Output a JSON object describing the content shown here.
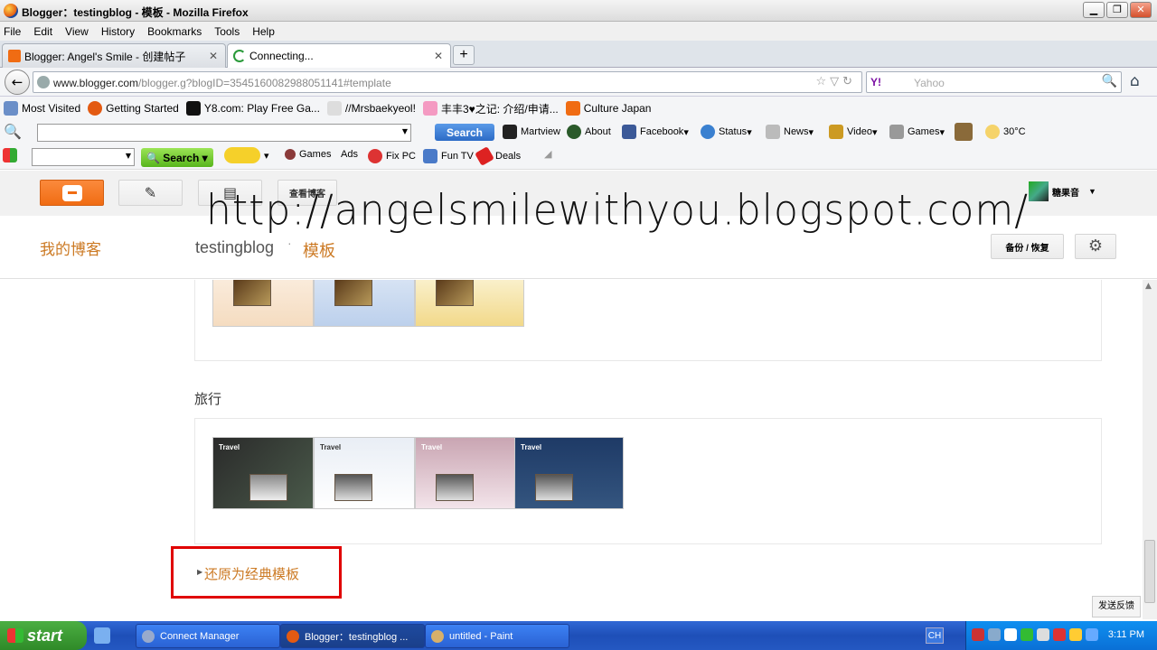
{
  "window": {
    "title": "Blogger：testingblog - 模板 - Mozilla Firefox"
  },
  "menu": [
    "File",
    "Edit",
    "View",
    "History",
    "Bookmarks",
    "Tools",
    "Help"
  ],
  "tabs": [
    {
      "label": "Blogger: Angel's Smile - 创建帖子",
      "active": false
    },
    {
      "label": "Connecting...",
      "active": true
    }
  ],
  "nav": {
    "url_host": "www.blogger.com",
    "url_path": "/blogger.g?blogID=3545160082988051141#template",
    "search_engine": "Y!",
    "search_placeholder": "Yahoo"
  },
  "bookmarks": [
    "Most Visited",
    "Getting Started",
    "Y8.com: Play Free Ga...",
    "//Mrsbaekyeol!",
    "丰丰3♥之记: 介绍/申请...",
    "Culture Japan"
  ],
  "toolbar1": {
    "search_button": "Search",
    "items": [
      "Martview",
      "About",
      "Facebook",
      "Status",
      "News",
      "Video",
      "Games",
      "30°C"
    ]
  },
  "toolbar2": {
    "search_button": "Search",
    "items": [
      "Games",
      "Ads",
      "Fix PC",
      "Fun TV",
      "Deals"
    ]
  },
  "blogger": {
    "view_blog_label": "查看博客",
    "username": "糖果音",
    "my_blogs": "我的博客",
    "blog_name": "testingblog",
    "separator": "·",
    "section": "模板",
    "backup_label": "备份 / 恢复",
    "watermark": "http://angelsmilewithyou.blogspot.com/"
  },
  "content": {
    "category_travel": "旅行",
    "travel_thumb_title": "Travel",
    "restore_classic": "还原为经典模板",
    "feedback": "发送反馈"
  },
  "taskbar": {
    "start": "start",
    "tasks": [
      {
        "label": "Connect Manager",
        "active": false
      },
      {
        "label": "Blogger：testingblog ...",
        "active": true
      },
      {
        "label": "untitled - Paint",
        "active": false
      }
    ],
    "language": "CH",
    "clock": "3:11 PM"
  },
  "colors": {
    "accent": "#cc7a24",
    "blogger_orange": "#f06c13",
    "highlight_border": "#e00000"
  }
}
